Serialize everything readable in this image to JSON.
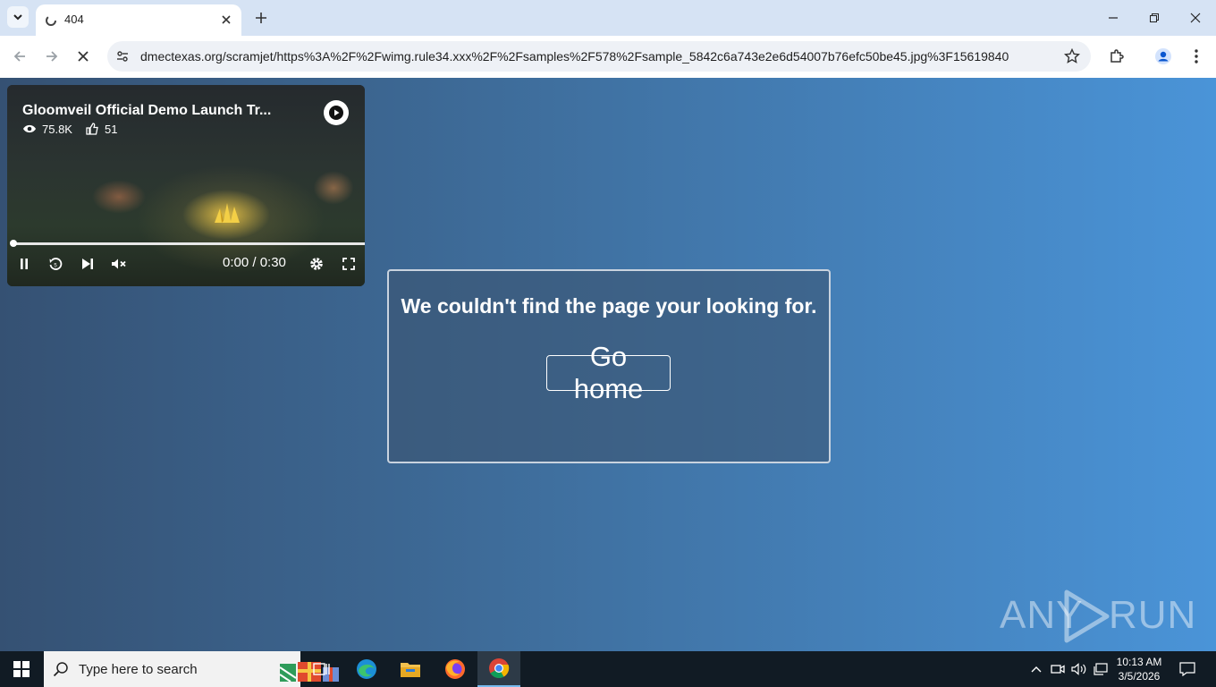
{
  "browser": {
    "tab": {
      "title": "404"
    },
    "url": "dmectexas.org/scramjet/https%3A%2F%2Fwimg.rule34.xxx%2F%2Fsamples%2F578%2Fsample_5842c6a743e2e6d54007b76efc50be45.jpg%3F15619840"
  },
  "video": {
    "title": "Gloomveil Official Demo Launch Tr...",
    "views": "75.8K",
    "likes": "51",
    "time": "0:00 / 0:30",
    "progress_fraction": 0.0
  },
  "error_card": {
    "message": "We couldn't find the page your looking for.",
    "button_label": "Go home"
  },
  "watermark": {
    "left": "ANY",
    "right": "RUN"
  },
  "taskbar": {
    "search_placeholder": "Type here to search",
    "time": "10:13 AM",
    "date": "3/5/2026",
    "apps": [
      "task-view",
      "edge",
      "file-explorer",
      "firefox",
      "chrome"
    ]
  },
  "colors": {
    "page_left": "#355173",
    "page_right": "#4a94d8",
    "taskbar": "#111b24",
    "tabstrip": "#d6e3f4"
  }
}
